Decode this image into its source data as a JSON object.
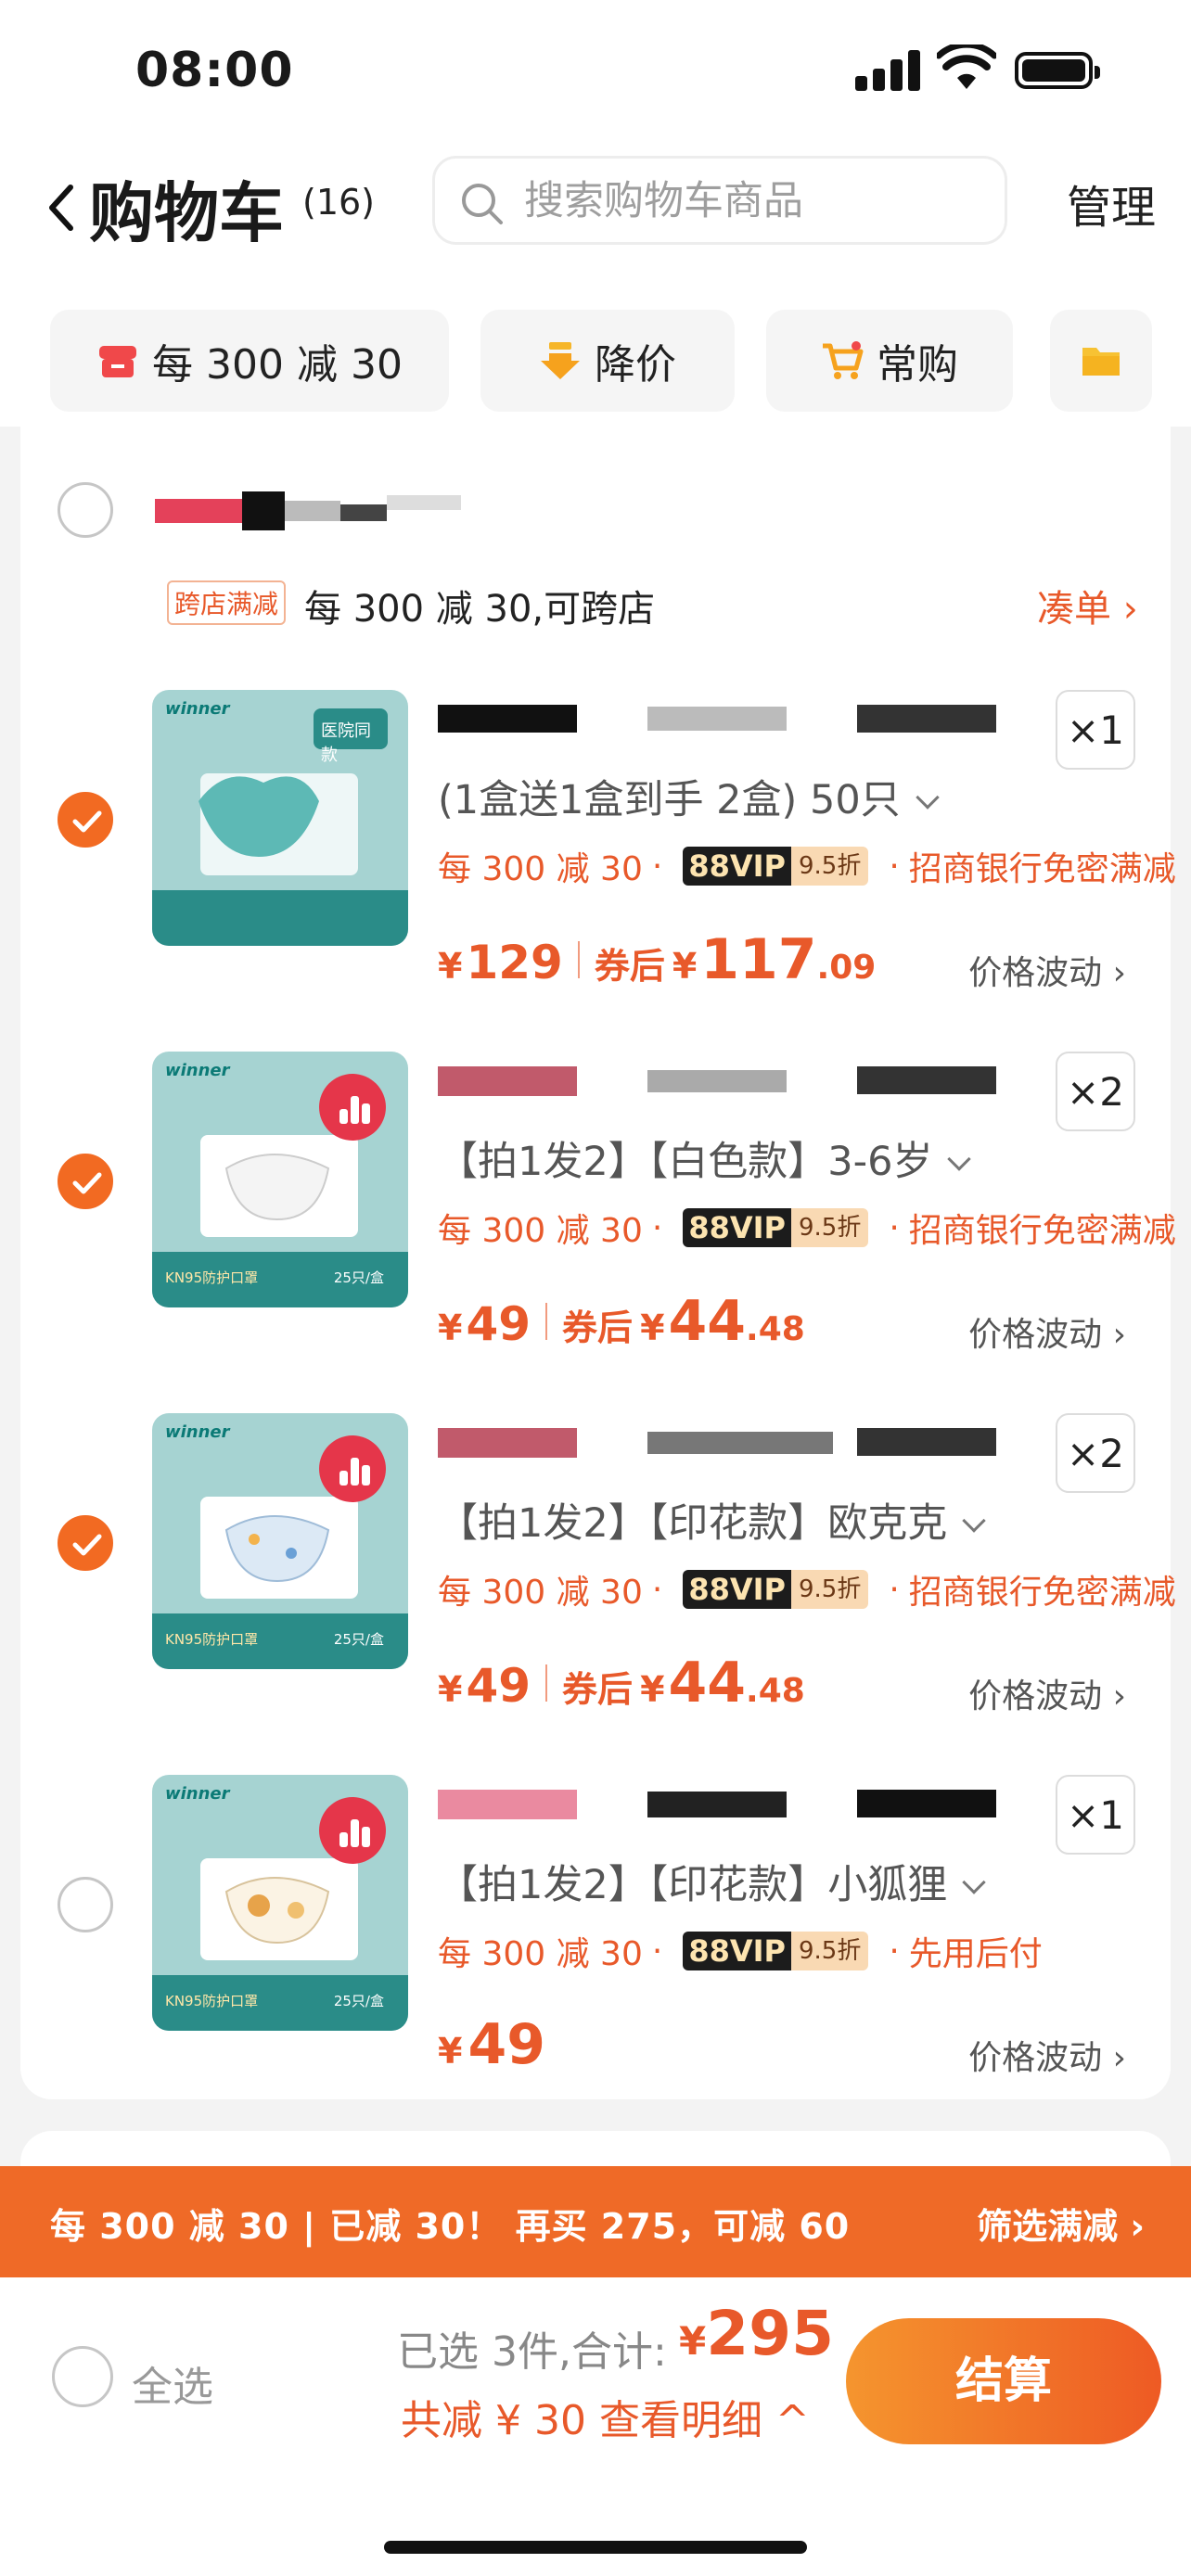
{
  "status_bar": {
    "time": "08:00"
  },
  "header": {
    "title": "购物车",
    "count": "(16)",
    "search_placeholder": "搜索购物车商品",
    "manage": "管理"
  },
  "chips": [
    {
      "label": "每 300 减 30",
      "icon": "store-sale-icon"
    },
    {
      "label": "降价",
      "icon": "price-drop-icon"
    },
    {
      "label": "常购",
      "icon": "cart-icon"
    },
    {
      "label": "",
      "icon": "folder-icon"
    }
  ],
  "shop": {
    "promo_tag": "跨店满减",
    "promo_text": "每 300 减 30,可跨店",
    "coudan": "凑单 ›"
  },
  "items": [
    {
      "spec": "(1盒送1盒到手 2盒) 50只",
      "promo": "每 300 减 30",
      "vip": "88VIP",
      "vip_discount": "9.5折",
      "extra": "招商银行免密满减",
      "price": "129",
      "after_label": "券后",
      "after_int": "117",
      "after_dec": ".09",
      "fluct": "价格波动 ›",
      "qty": "×1",
      "checked": true
    },
    {
      "spec": "【拍1发2】【白色款】3-6岁",
      "promo": "每 300 减 30",
      "vip": "88VIP",
      "vip_discount": "9.5折",
      "extra": "招商银行免密满减",
      "price": "49",
      "after_label": "券后",
      "after_int": "44",
      "after_dec": ".48",
      "fluct": "价格波动 ›",
      "qty": "×2",
      "checked": true
    },
    {
      "spec": "【拍1发2】【印花款】欧克克",
      "promo": "每 300 减 30",
      "vip": "88VIP",
      "vip_discount": "9.5折",
      "extra": "招商银行免密满减",
      "price": "49",
      "after_label": "券后",
      "after_int": "44",
      "after_dec": ".48",
      "fluct": "价格波动 ›",
      "qty": "×2",
      "checked": true
    },
    {
      "spec": "【拍1发2】【印花款】小狐狸",
      "promo": "每 300 减 30",
      "vip": "88VIP",
      "vip_discount": "9.5折",
      "extra": "先用后付",
      "price": "49",
      "fluct": "价格波动 ›",
      "qty": "×1",
      "checked": false
    }
  ],
  "promo_bar": {
    "left": "每 300 减 30 | 已减 30！ 再买 275，可减 60",
    "right": "筛选满减 ›"
  },
  "footer": {
    "select_all": "全选",
    "summary": "已选 3件,合计:",
    "total_yen": "¥",
    "total": "295",
    "discount": "共减 ¥ 30 查看明细 ^",
    "checkout": "结算"
  },
  "colors": {
    "accent": "#ef6a27",
    "brand_teal": "#2a8c88"
  }
}
